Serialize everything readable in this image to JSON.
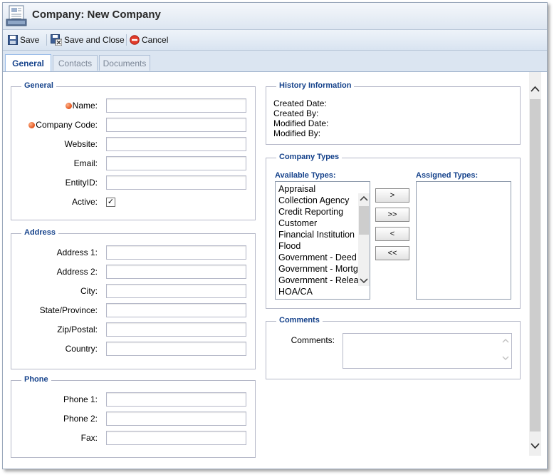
{
  "window": {
    "title": "Company: New Company"
  },
  "toolbar": {
    "save": "Save",
    "save_close": "Save and Close",
    "cancel": "Cancel"
  },
  "tabs": [
    {
      "label": "General",
      "active": true
    },
    {
      "label": "Contacts",
      "active": false
    },
    {
      "label": "Documents",
      "active": false
    }
  ],
  "general": {
    "legend": "General",
    "name_label": "Name:",
    "code_label": "Company Code:",
    "website_label": "Website:",
    "email_label": "Email:",
    "entity_label": "EntityID:",
    "active_label": "Active:",
    "active_checked": true,
    "checkmark": "✓"
  },
  "address": {
    "legend": "Address",
    "address1": "Address 1:",
    "address2": "Address 2:",
    "city": "City:",
    "state": "State/Province:",
    "zip": "Zip/Postal:",
    "country": "Country:"
  },
  "phone": {
    "legend": "Phone",
    "phone1": "Phone 1:",
    "phone2": "Phone 2:",
    "fax": "Fax:"
  },
  "history": {
    "legend": "History Information",
    "created_date": "Created Date:",
    "created_by": "Created By:",
    "modified_date": "Modified Date:",
    "modified_by": "Modified By:"
  },
  "company_types": {
    "legend": "Company Types",
    "available_label": "Available Types:",
    "assigned_label": "Assigned Types:",
    "available": [
      "Appraisal",
      "Collection Agency",
      "Credit Reporting",
      "Customer",
      "Financial Institution",
      "Flood",
      "Government - Deed",
      "Government - Mortgage",
      "Government - Release",
      "HOA/CA"
    ],
    "buttons": {
      "add": ">",
      "add_all": ">>",
      "remove": "<",
      "remove_all": "<<"
    }
  },
  "comments": {
    "legend": "Comments",
    "label": "Comments:"
  },
  "colors": {
    "legend_blue": "#15428b",
    "required_orange": "#e2521a"
  }
}
